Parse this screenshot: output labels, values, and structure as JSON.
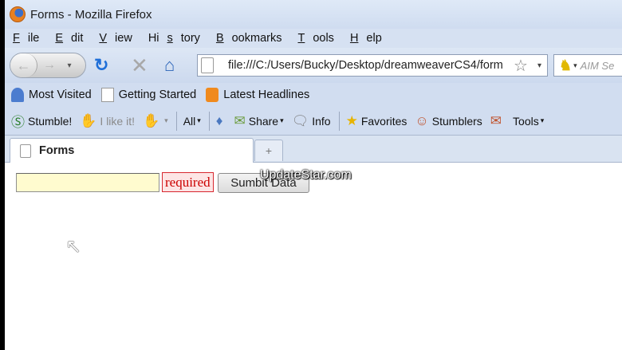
{
  "window": {
    "title": "Forms - Mozilla Firefox"
  },
  "menu": {
    "items": [
      {
        "label": "File",
        "access": "F",
        "rest": "ile"
      },
      {
        "label": "Edit",
        "access": "E",
        "rest": "dit"
      },
      {
        "label": "View",
        "access": "V",
        "rest": "iew"
      },
      {
        "label": "History",
        "access": "s",
        "pre": "Hi",
        "rest": "tory"
      },
      {
        "label": "Bookmarks",
        "access": "B",
        "rest": "ookmarks"
      },
      {
        "label": "Tools",
        "access": "T",
        "rest": "ools"
      },
      {
        "label": "Help",
        "access": "H",
        "rest": "elp"
      }
    ]
  },
  "nav": {
    "url": "file:///C:/Users/Bucky/Desktop/dreamweaverCS4/form",
    "search_placeholder": "AIM Se"
  },
  "bookmarks": {
    "most_visited": "Most Visited",
    "getting_started": "Getting Started",
    "latest_headlines": "Latest Headlines"
  },
  "stumble": {
    "stumble": "Stumble!",
    "i_like_it": "I like it!",
    "all": "All",
    "share": "Share",
    "info": "Info",
    "favorites": "Favorites",
    "stumblers": "Stumblers",
    "tools": "Tools"
  },
  "tabs": [
    {
      "title": "Forms"
    }
  ],
  "newtab_symbol": "+",
  "form": {
    "input_value": "",
    "required_text": "required",
    "submit_label": "Sumbit Data"
  },
  "watermark": "UpdateStar.com",
  "colors": {
    "input_bg": "#fffbcf",
    "required_border": "#d7272f",
    "required_text": "#cc0000",
    "chrome_bg": "#d1ddf0"
  }
}
